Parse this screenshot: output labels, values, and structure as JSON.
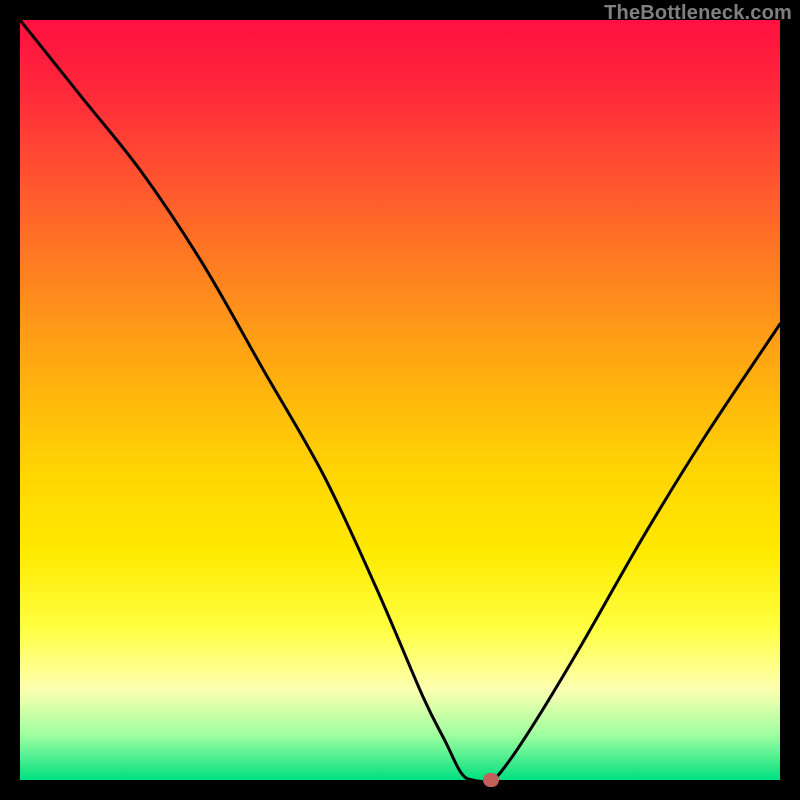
{
  "watermark": "TheBottleneck.com",
  "chart_data": {
    "type": "line",
    "title": "",
    "xlabel": "",
    "ylabel": "",
    "xlim": [
      0,
      100
    ],
    "ylim": [
      0,
      100
    ],
    "background_gradient": {
      "top": "#ff1040",
      "bottom": "#00e080"
    },
    "series": [
      {
        "name": "bottleneck-curve",
        "color": "#000000",
        "x": [
          0,
          8,
          16,
          24,
          32,
          40,
          47,
          53,
          56,
          58,
          59.5,
          62,
          64,
          68,
          74,
          82,
          90,
          100
        ],
        "values": [
          100,
          90,
          80,
          68,
          54,
          40,
          25,
          11,
          5,
          1,
          0,
          0,
          2,
          8,
          18,
          32,
          45,
          60
        ]
      }
    ],
    "marker": {
      "name": "optimal-point",
      "x": 62,
      "y": 0,
      "color": "#c06058"
    }
  }
}
